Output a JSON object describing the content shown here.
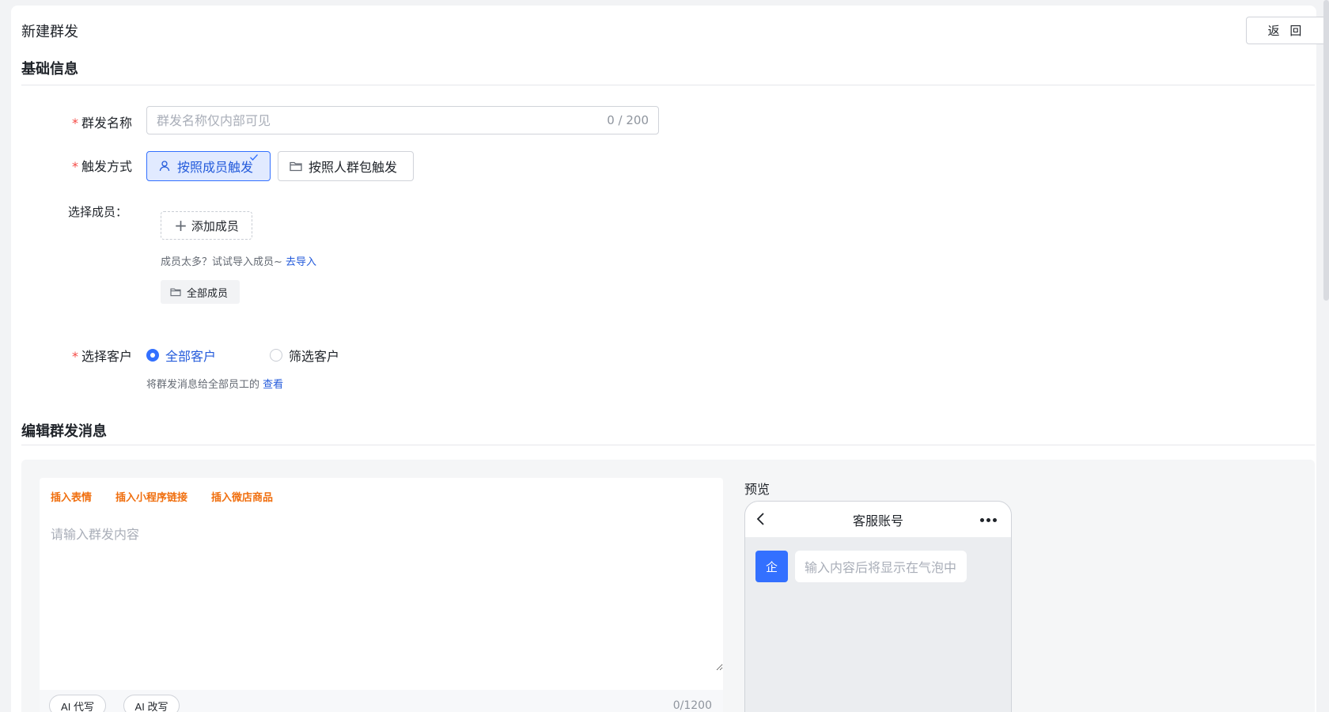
{
  "header": {
    "title": "新建群发",
    "back_label": "返 回"
  },
  "basic_info": {
    "section_title": "基础信息",
    "name_field": {
      "label": "群发名称",
      "placeholder": "群发名称仅内部可见",
      "value": "",
      "count": "0 / 200"
    },
    "trigger": {
      "label": "触发方式",
      "options": [
        {
          "label": "按照成员触发",
          "icon": "user-icon",
          "selected": true
        },
        {
          "label": "按照人群包触发",
          "icon": "folder-icon",
          "selected": false
        }
      ]
    },
    "members": {
      "label": "选择成员：",
      "add_label": "添加成员",
      "hint": "成员太多？试试导入成员~ ",
      "import_link": "去导入",
      "tag_label": "全部成员"
    },
    "customers": {
      "label": "选择客户",
      "options": [
        {
          "label": "全部客户",
          "selected": true
        },
        {
          "label": "筛选客户",
          "selected": false
        }
      ],
      "hint": "将群发消息给全部员工的 ",
      "view_link": "查看"
    }
  },
  "edit_message": {
    "section_title": "编辑群发消息",
    "insert_actions": [
      "插入表情",
      "插入小程序链接",
      "插入微店商品"
    ],
    "content_placeholder": "请输入群发内容",
    "ai_buttons": [
      "AI 代写",
      "AI 改写"
    ],
    "count": "0/1200"
  },
  "preview": {
    "label": "预览",
    "phone_title": "客服账号",
    "avatar_text": "企",
    "bubble_text": "输入内容后将显示在气泡中"
  },
  "colors": {
    "primary": "#3370ff",
    "accent_orange": "#f06f0f",
    "required": "#f54a45"
  }
}
